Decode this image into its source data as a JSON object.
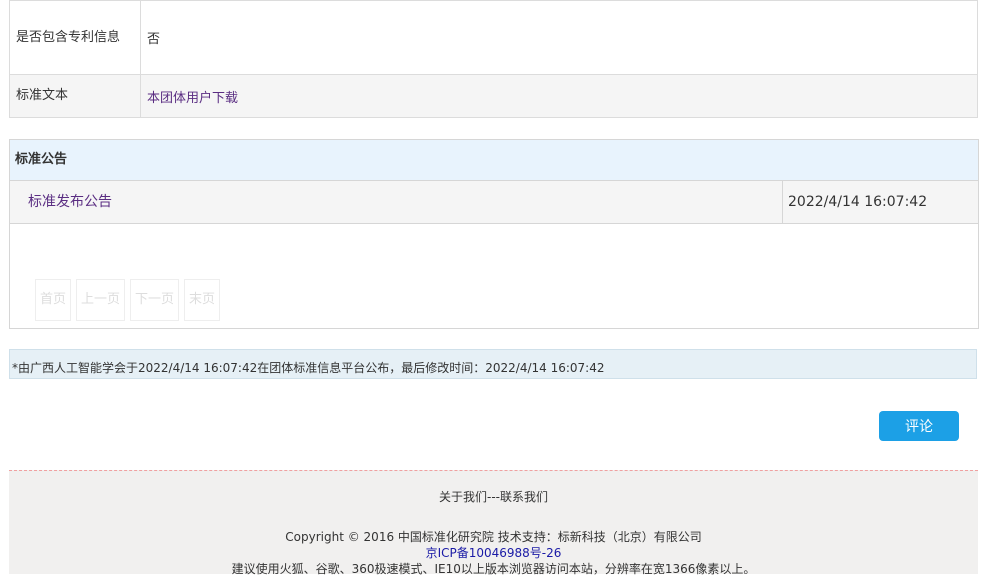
{
  "info_table": {
    "patent_label": "是否包含专利信息",
    "patent_value": "否",
    "text_label": "标准文本",
    "text_link": "本团体用户下载"
  },
  "notice": {
    "header": "标准公告",
    "items": [
      {
        "title": "标准发布公告",
        "date": "2022/4/14 16:07:42"
      }
    ],
    "pager": {
      "first": "首页",
      "prev": "上一页",
      "next": "下一页",
      "last": "末页"
    }
  },
  "footnote": "*由广西人工智能学会于2022/4/14 16:07:42在团体标准信息平台公布，最后修改时间：2022/4/14 16:07:42",
  "comment_button": "评论",
  "footer": {
    "links": "关于我们---联系我们",
    "copyright": "Copyright © 2016 中国标准化研究院 技术支持：标新科技（北京）有限公司",
    "icp": "京ICP备10046988号-26",
    "advice": "建议使用火狐、谷歌、360极速模式、IE10以上版本浏览器访问本站，分辨率在宽1366像素以上。"
  },
  "colors": {
    "accent": "#1ca0e6",
    "link": "#5a2d82",
    "header_bg": "#e8f3fd"
  }
}
